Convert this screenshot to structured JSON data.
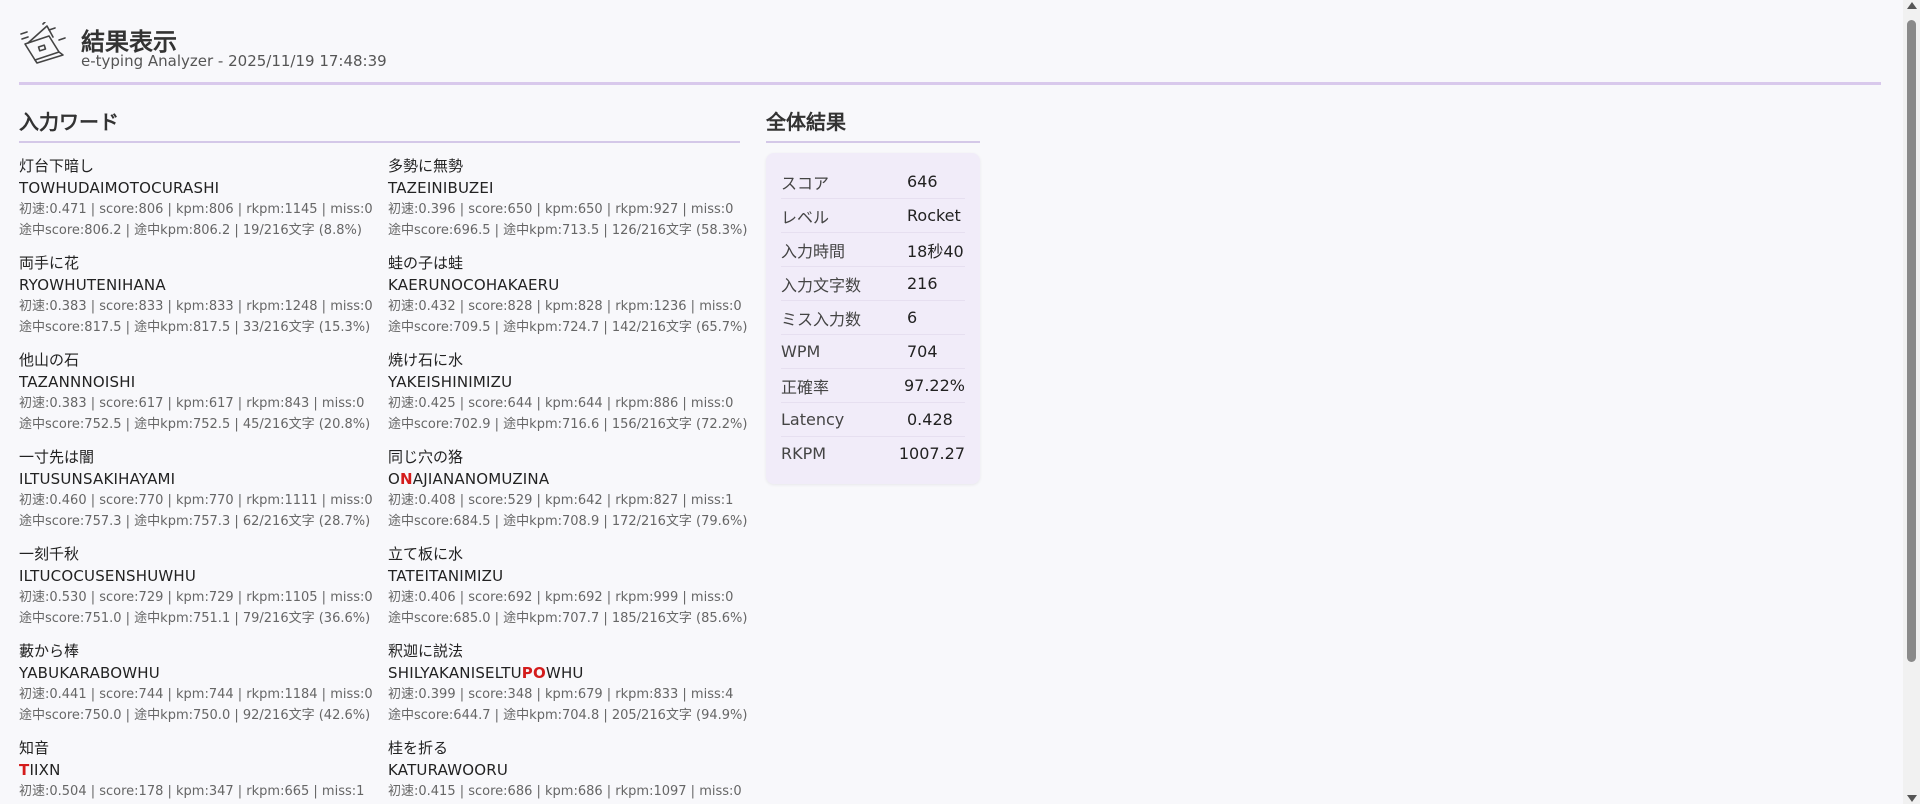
{
  "header": {
    "title": "結果表示",
    "subtitle": "e-typing Analyzer - 2025/11/19 17:48:39",
    "logo_icon": "laptop-sketch-icon"
  },
  "words_section": {
    "title": "入力ワード",
    "items": [
      {
        "jp": "灯台下暗し",
        "roma": [
          {
            "t": "TOWHUDAIMOTOCURASHI",
            "m": false
          }
        ],
        "stat1": "初速:0.471 | score:806 | kpm:806 | rkpm:1145 | miss:0",
        "stat2": "途中score:806.2 | 途中kpm:806.2 | 19/216文字 (8.8%)"
      },
      {
        "jp": "多勢に無勢",
        "roma": [
          {
            "t": "TAZEINIBUZEI",
            "m": false
          }
        ],
        "stat1": "初速:0.396 | score:650 | kpm:650 | rkpm:927 | miss:0",
        "stat2": "途中score:696.5 | 途中kpm:713.5 | 126/216文字 (58.3%)"
      },
      {
        "jp": "両手に花",
        "roma": [
          {
            "t": "RYOWHUTENIHANA",
            "m": false
          }
        ],
        "stat1": "初速:0.383 | score:833 | kpm:833 | rkpm:1248 | miss:0",
        "stat2": "途中score:817.5 | 途中kpm:817.5 | 33/216文字 (15.3%)"
      },
      {
        "jp": "蛙の子は蛙",
        "roma": [
          {
            "t": "KAERUNOCOHAKAERU",
            "m": false
          }
        ],
        "stat1": "初速:0.432 | score:828 | kpm:828 | rkpm:1236 | miss:0",
        "stat2": "途中score:709.5 | 途中kpm:724.7 | 142/216文字 (65.7%)"
      },
      {
        "jp": "他山の石",
        "roma": [
          {
            "t": "TAZANNNOISHI",
            "m": false
          }
        ],
        "stat1": "初速:0.383 | score:617 | kpm:617 | rkpm:843 | miss:0",
        "stat2": "途中score:752.5 | 途中kpm:752.5 | 45/216文字 (20.8%)"
      },
      {
        "jp": "焼け石に水",
        "roma": [
          {
            "t": "YAKEISHINIMIZU",
            "m": false
          }
        ],
        "stat1": "初速:0.425 | score:644 | kpm:644 | rkpm:886 | miss:0",
        "stat2": "途中score:702.9 | 途中kpm:716.6 | 156/216文字 (72.2%)"
      },
      {
        "jp": "一寸先は闇",
        "roma": [
          {
            "t": "ILTUSUNSAKIHAYAMI",
            "m": false
          }
        ],
        "stat1": "初速:0.460 | score:770 | kpm:770 | rkpm:1111 | miss:0",
        "stat2": "途中score:757.3 | 途中kpm:757.3 | 62/216文字 (28.7%)"
      },
      {
        "jp": "同じ穴の狢",
        "roma": [
          {
            "t": "O",
            "m": false
          },
          {
            "t": "N",
            "m": true
          },
          {
            "t": "AJIANANOMUZINA",
            "m": false
          }
        ],
        "stat1": "初速:0.408 | score:529 | kpm:642 | rkpm:827 | miss:1",
        "stat2": "途中score:684.5 | 途中kpm:708.9 | 172/216文字 (79.6%)"
      },
      {
        "jp": "一刻千秋",
        "roma": [
          {
            "t": "ILTUCOCUSENSHUWHU",
            "m": false
          }
        ],
        "stat1": "初速:0.530 | score:729 | kpm:729 | rkpm:1105 | miss:0",
        "stat2": "途中score:751.0 | 途中kpm:751.1 | 79/216文字 (36.6%)"
      },
      {
        "jp": "立て板に水",
        "roma": [
          {
            "t": "TATEITANIMIZU",
            "m": false
          }
        ],
        "stat1": "初速:0.406 | score:692 | kpm:692 | rkpm:999 | miss:0",
        "stat2": "途中score:685.0 | 途中kpm:707.7 | 185/216文字 (85.6%)"
      },
      {
        "jp": "藪から棒",
        "roma": [
          {
            "t": "YABUKARABOWHU",
            "m": false
          }
        ],
        "stat1": "初速:0.441 | score:744 | kpm:744 | rkpm:1184 | miss:0",
        "stat2": "途中score:750.0 | 途中kpm:750.0 | 92/216文字 (42.6%)"
      },
      {
        "jp": "釈迦に説法",
        "roma": [
          {
            "t": "SHILYAKANISELTU",
            "m": false
          },
          {
            "t": "PO",
            "m": true
          },
          {
            "t": "WHU",
            "m": false
          }
        ],
        "stat1": "初速:0.399 | score:348 | kpm:679 | rkpm:833 | miss:4",
        "stat2": "途中score:644.7 | 途中kpm:704.8 | 205/216文字 (94.9%)"
      },
      {
        "jp": "知音",
        "roma": [
          {
            "t": "T",
            "m": true
          },
          {
            "t": "IIXN",
            "m": false
          }
        ],
        "stat1": "初速:0.504 | score:178 | kpm:347 | rkpm:665 | miss:1",
        "stat2": ""
      },
      {
        "jp": "桂を折る",
        "roma": [
          {
            "t": "KATURAWOORU",
            "m": false
          }
        ],
        "stat1": "初速:0.415 | score:686 | kpm:686 | rkpm:1097 | miss:0",
        "stat2": ""
      }
    ]
  },
  "summary": {
    "title": "全体結果",
    "rows": [
      {
        "label": "スコア",
        "value": "646"
      },
      {
        "label": "レベル",
        "value": "Rocket"
      },
      {
        "label": "入力時間",
        "value": "18秒40"
      },
      {
        "label": "入力文字数",
        "value": "216"
      },
      {
        "label": "ミス入力数",
        "value": "6"
      },
      {
        "label": "WPM",
        "value": "704"
      },
      {
        "label": "正確率",
        "value": "97.22%"
      },
      {
        "label": "Latency",
        "value": "0.428"
      },
      {
        "label": "RKPM",
        "value": "1007.27"
      }
    ]
  },
  "colors": {
    "accent_rule": "#d9c9ec",
    "miss": "#d41c1c",
    "summary_bg": "#f1ecf9"
  }
}
